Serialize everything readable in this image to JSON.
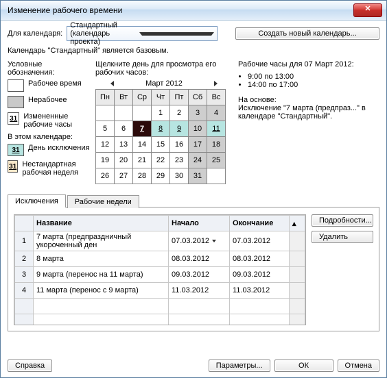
{
  "title": "Изменение рабочего времени",
  "for_calendar_label": "Для календаря:",
  "selected_calendar": "Стандартный (календарь проекта)",
  "create_calendar_btn": "Создать новый календарь...",
  "base_note": "Календарь \"Стандартный\" является базовым.",
  "legend": {
    "header": "Условные обозначения:",
    "work": "Рабочее время",
    "nonwork": "Нерабочее",
    "modified": "Измененные рабочие часы",
    "in_this_calendar": "В этом календаре:",
    "exception_day": "День исключения",
    "nonstd_week": "Нестандартная рабочая неделя",
    "swatch_num": "31"
  },
  "calendar": {
    "instruction": "Щелкните день для просмотра его рабочих часов:",
    "month": "Март 2012",
    "dow": [
      "Пн",
      "Вт",
      "Ср",
      "Чт",
      "Пт",
      "Сб",
      "Вс"
    ],
    "weeks": [
      [
        {
          "v": ""
        },
        {
          "v": ""
        },
        {
          "v": ""
        },
        {
          "v": "1"
        },
        {
          "v": "2"
        },
        {
          "v": "3",
          "nw": true
        },
        {
          "v": "4",
          "nw": true
        }
      ],
      [
        {
          "v": "5"
        },
        {
          "v": "6"
        },
        {
          "v": "7",
          "sel": true,
          "ul": true
        },
        {
          "v": "8",
          "ex": true,
          "ul": true
        },
        {
          "v": "9",
          "ex": true,
          "ul": true
        },
        {
          "v": "10",
          "nw": true
        },
        {
          "v": "11",
          "ex": true,
          "ul": true
        }
      ],
      [
        {
          "v": "12"
        },
        {
          "v": "13"
        },
        {
          "v": "14"
        },
        {
          "v": "15"
        },
        {
          "v": "16"
        },
        {
          "v": "17",
          "nw": true
        },
        {
          "v": "18",
          "nw": true
        }
      ],
      [
        {
          "v": "19"
        },
        {
          "v": "20"
        },
        {
          "v": "21"
        },
        {
          "v": "22"
        },
        {
          "v": "23"
        },
        {
          "v": "24",
          "nw": true
        },
        {
          "v": "25",
          "nw": true
        }
      ],
      [
        {
          "v": "26"
        },
        {
          "v": "27"
        },
        {
          "v": "28"
        },
        {
          "v": "29"
        },
        {
          "v": "30"
        },
        {
          "v": "31",
          "nw": true
        },
        {
          "v": ""
        }
      ]
    ]
  },
  "detail": {
    "title": "Рабочие часы для 07 Март 2012:",
    "hours": [
      "9:00 по 13:00",
      "14:00 по 17:00"
    ],
    "basis_label": "На основе:",
    "basis_text": "Исключение \"7 марта (предпраз...\" в календаре \"Стандартный\"."
  },
  "tabs": {
    "exceptions": "Исключения",
    "weeks": "Рабочие недели"
  },
  "grid": {
    "cols": {
      "name": "Название",
      "start": "Начало",
      "end": "Окончание"
    },
    "rows": [
      {
        "n": "1",
        "name": "7 марта (предпраздничный укороченный ден",
        "start": "07.03.2012",
        "end": "07.03.2012",
        "sel": true
      },
      {
        "n": "2",
        "name": "8 марта",
        "start": "08.03.2012",
        "end": "08.03.2012"
      },
      {
        "n": "3",
        "name": "9 марта (перенос на 11 марта)",
        "start": "09.03.2012",
        "end": "09.03.2012"
      },
      {
        "n": "4",
        "name": "11 марта (перенос с 9 марта)",
        "start": "11.03.2012",
        "end": "11.03.2012"
      }
    ]
  },
  "side": {
    "details": "Подробности...",
    "delete": "Удалить"
  },
  "footer": {
    "help": "Справка",
    "options": "Параметры...",
    "ok": "ОК",
    "cancel": "Отмена"
  }
}
